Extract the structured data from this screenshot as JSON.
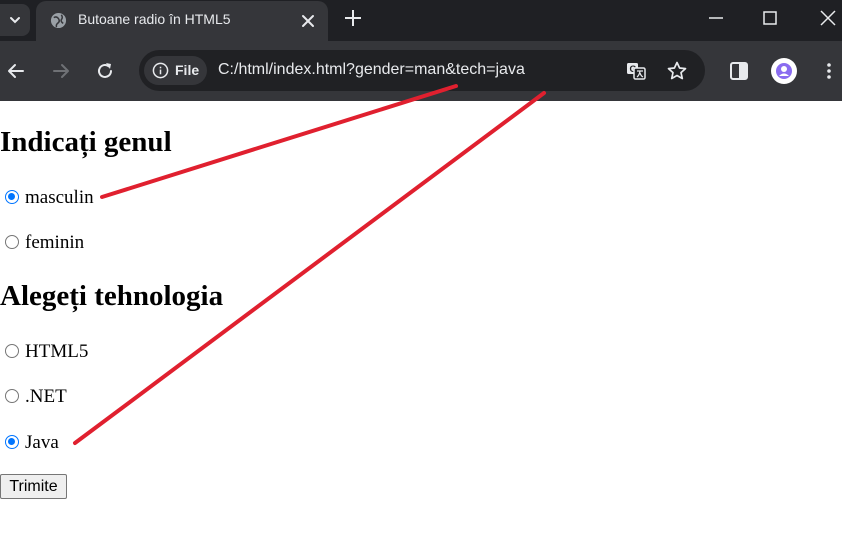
{
  "browser": {
    "tab_title": "Butoane radio în HTML5",
    "site_info_label": "File",
    "url": "C:/html/index.html?gender=man&tech=java"
  },
  "page": {
    "heading_gender": "Indicați genul",
    "gender_options": [
      {
        "label": "masculin",
        "checked": true
      },
      {
        "label": "feminin",
        "checked": false
      }
    ],
    "heading_tech": "Alegeți tehnologia",
    "tech_options": [
      {
        "label": "HTML5",
        "checked": false
      },
      {
        "label": ".NET",
        "checked": false
      },
      {
        "label": "Java",
        "checked": true
      }
    ],
    "submit_label": "Trimite"
  },
  "colors": {
    "radio_checked": "#0075ff",
    "annotation_line": "#e0202f",
    "chrome_dark": "#1f2024",
    "chrome_toolbar": "#35363a"
  }
}
